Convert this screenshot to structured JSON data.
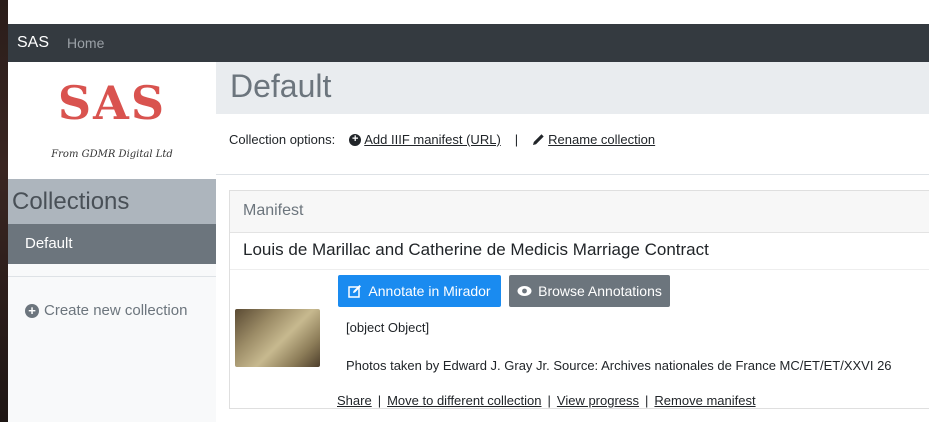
{
  "navbar": {
    "brand": "SAS",
    "home": "Home"
  },
  "sidebar": {
    "logo": {
      "title": "SAS",
      "subtitle": "From GDMR Digital Ltd"
    },
    "collections_header": "Collections",
    "active_collection": "Default",
    "create_new": "Create new collection"
  },
  "main": {
    "title": "Default",
    "collection_options_label": "Collection options:",
    "add_manifest": "Add IIIF manifest (URL)",
    "separator": "|",
    "rename": "Rename collection"
  },
  "card": {
    "header": "Manifest",
    "manifest_title": "Louis de Marillac and Catherine de Medicis Marriage Contract",
    "annotate_button": "Annotate in Mirador",
    "browse_button": "Browse Annotations",
    "object_text": "[object Object]",
    "description": "Photos taken by Edward J. Gray Jr. Source: Archives nationales de France MC/ET/ET/XXVI 26",
    "actions": {
      "share": "Share",
      "move": "Move to different collection",
      "progress": "View progress",
      "remove": "Remove manifest",
      "separator": "|"
    }
  },
  "colors": {
    "navbar": "#343a40",
    "logo_red": "#d9534f",
    "primary": "#1a8bf0",
    "secondary": "#6c757d"
  }
}
